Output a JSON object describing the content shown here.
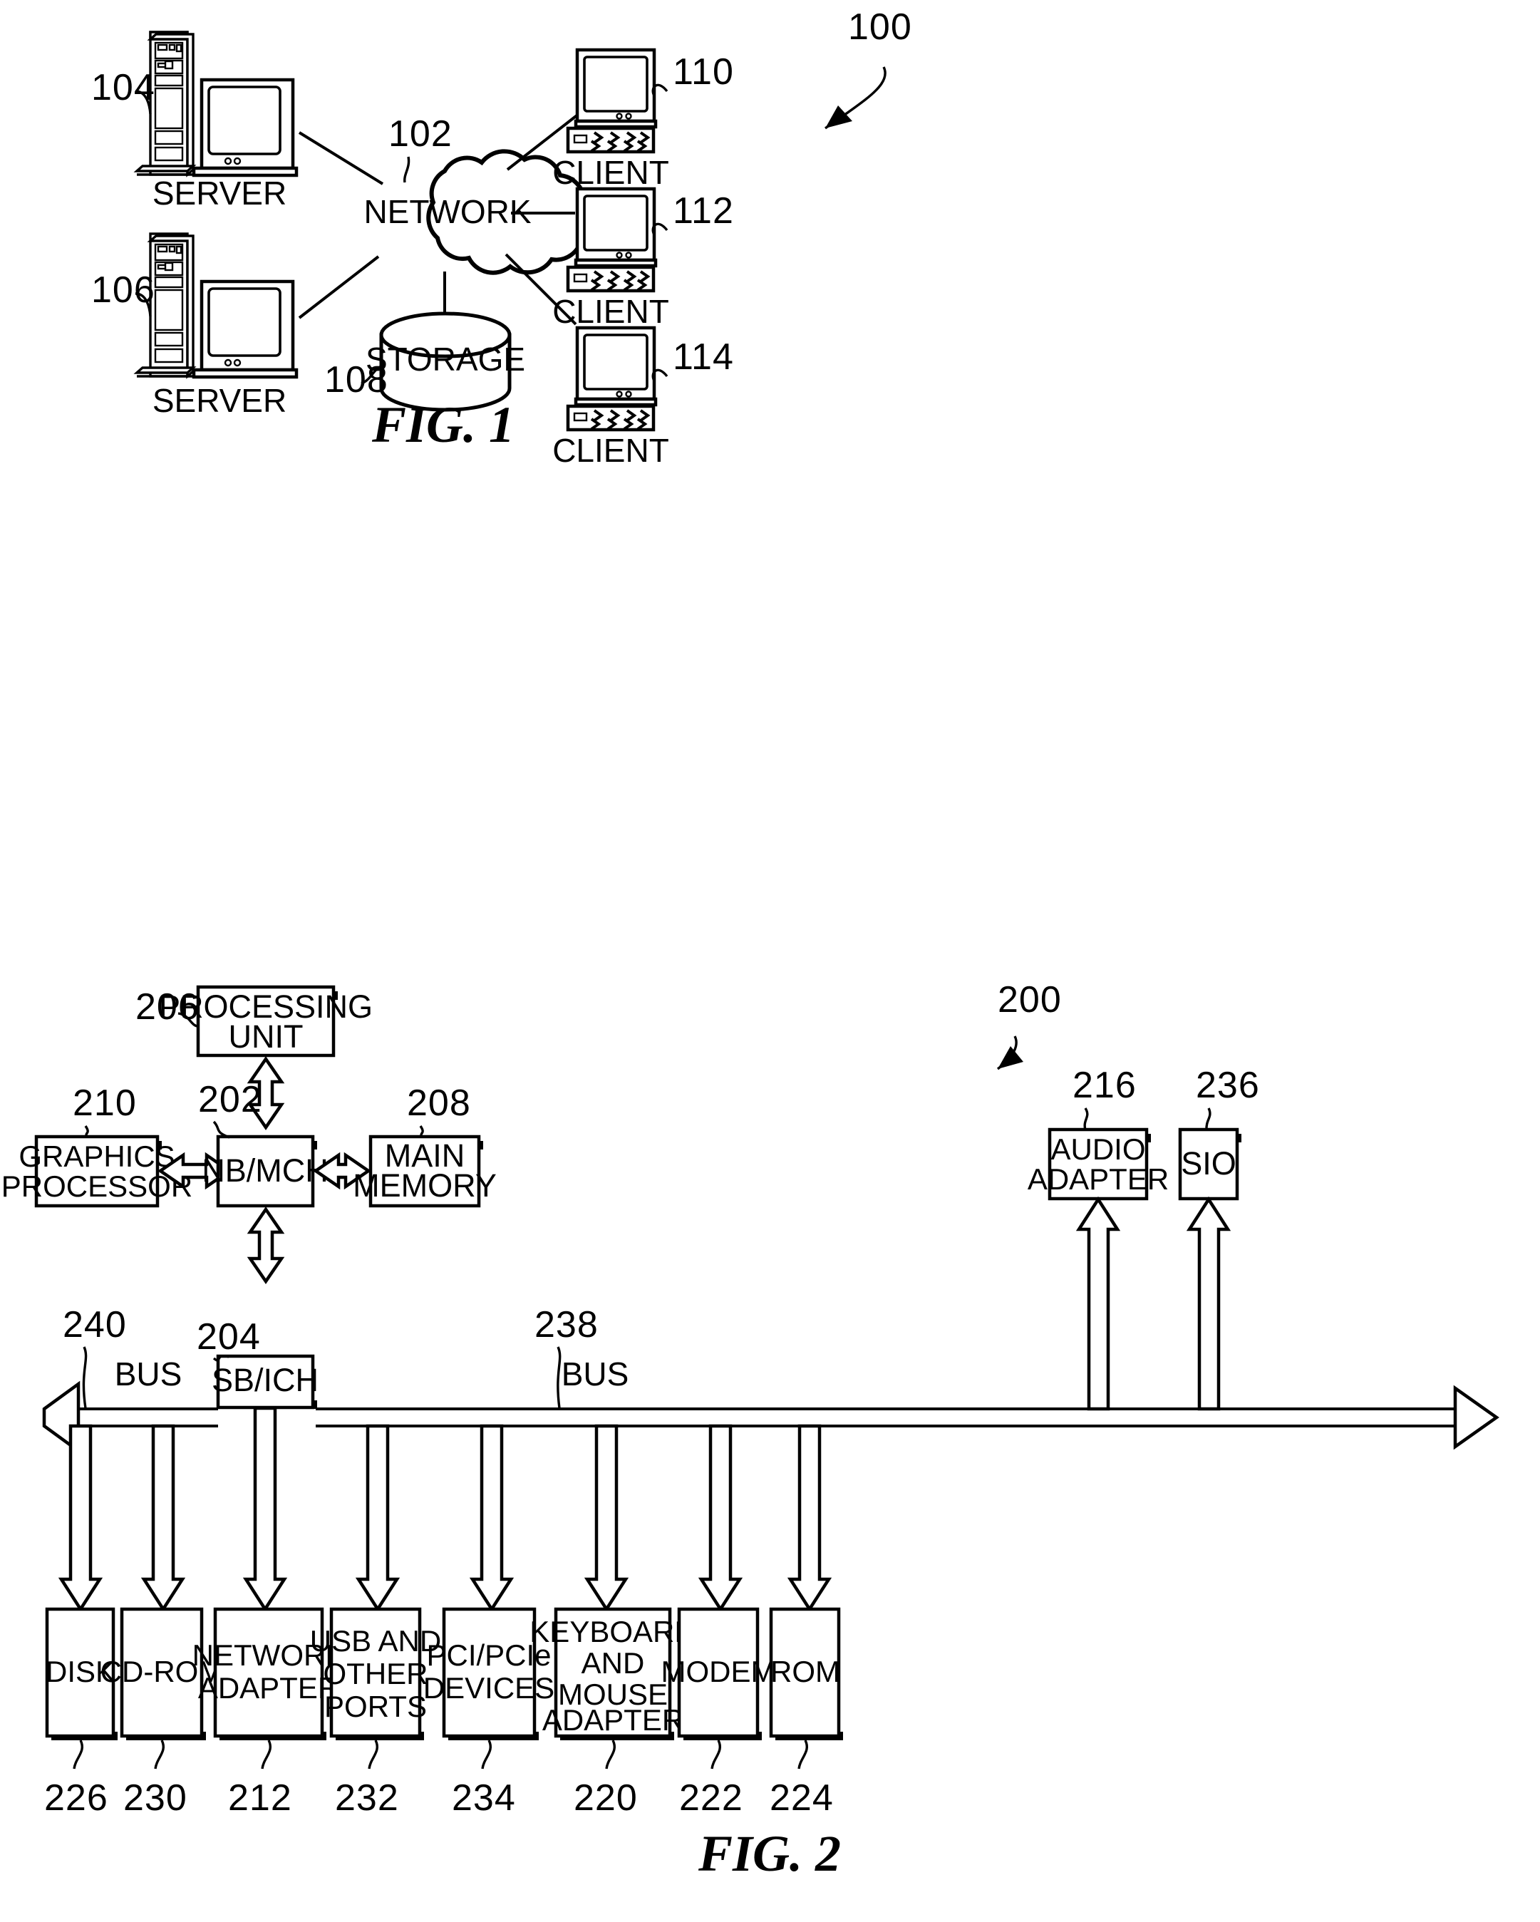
{
  "figures": [
    {
      "id": "fig1",
      "caption": "FIG. 1",
      "system_ref": "100",
      "nodes": {
        "network": {
          "label": "NETWORK",
          "ref": "102"
        },
        "server_top": {
          "label": "SERVER",
          "ref": "104"
        },
        "server_bottom": {
          "label": "SERVER",
          "ref": "106"
        },
        "storage": {
          "label": "STORAGE",
          "ref": "108"
        },
        "client_top": {
          "label": "CLIENT",
          "ref": "110"
        },
        "client_middle": {
          "label": "CLIENT",
          "ref": "112"
        },
        "client_bottom": {
          "label": "CLIENT",
          "ref": "114"
        }
      }
    },
    {
      "id": "fig2",
      "caption": "FIG. 2",
      "system_ref": "200",
      "blocks": [
        {
          "key": "processing_unit",
          "label_lines": [
            "PROCESSING",
            "UNIT"
          ],
          "ref": "206"
        },
        {
          "key": "nb_mch",
          "label_lines": [
            "NB/MCH"
          ],
          "ref": "202"
        },
        {
          "key": "graphics_processor",
          "label_lines": [
            "GRAPHICS",
            "PROCESSOR"
          ],
          "ref": "210"
        },
        {
          "key": "main_memory",
          "label_lines": [
            "MAIN",
            "MEMORY"
          ],
          "ref": "208"
        },
        {
          "key": "audio_adapter",
          "label_lines": [
            "AUDIO",
            "ADAPTER"
          ],
          "ref": "216"
        },
        {
          "key": "sio",
          "label_lines": [
            "SIO"
          ],
          "ref": "236"
        },
        {
          "key": "sb_ich",
          "label_lines": [
            "SB/ICH"
          ],
          "ref": "204"
        },
        {
          "key": "disk",
          "label_lines": [
            "DISK"
          ],
          "ref": "226"
        },
        {
          "key": "cdrom",
          "label_lines": [
            "CD-ROM"
          ],
          "ref": "230"
        },
        {
          "key": "network_adapter",
          "label_lines": [
            "NETWORK",
            "ADAPTER"
          ],
          "ref": "212"
        },
        {
          "key": "usb_ports",
          "label_lines": [
            "USB AND",
            "OTHER",
            "PORTS"
          ],
          "ref": "232"
        },
        {
          "key": "pci_devices",
          "label_lines": [
            "PCI/PCIe",
            "DEVICES"
          ],
          "ref": "234"
        },
        {
          "key": "kbd_mouse",
          "label_lines": [
            "KEYBOARD",
            "AND",
            "MOUSE",
            "ADAPTER"
          ],
          "ref": "220"
        },
        {
          "key": "modem",
          "label_lines": [
            "MODEM"
          ],
          "ref": "222"
        },
        {
          "key": "rom",
          "label_lines": [
            "ROM"
          ],
          "ref": "224"
        }
      ],
      "buses": [
        {
          "key": "bus_left",
          "label": "BUS",
          "ref": "240"
        },
        {
          "key": "bus_right",
          "label": "BUS",
          "ref": "238"
        }
      ]
    }
  ],
  "colors": {
    "ink": "#000000",
    "paper": "#ffffff"
  }
}
